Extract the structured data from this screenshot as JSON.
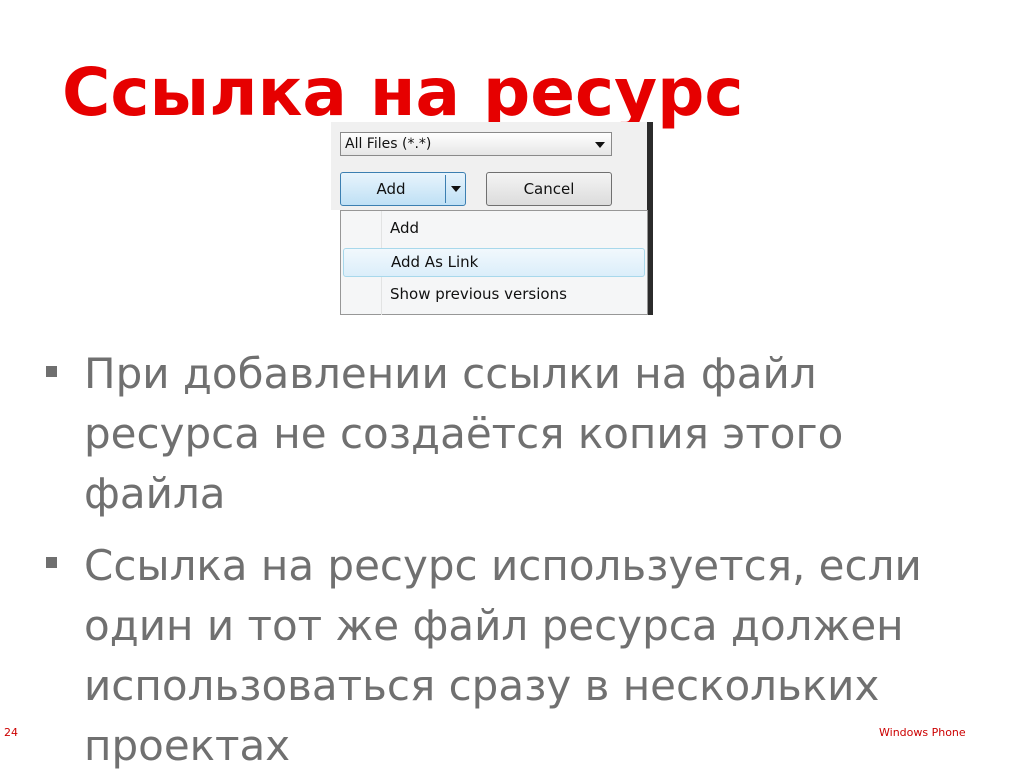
{
  "slide": {
    "title": "Ссылка на ресурс",
    "page_number": "24",
    "footer_brand": "Windows Phone"
  },
  "dialog": {
    "file_filter": "All Files (*.*)",
    "add_button": "Add",
    "cancel_button": "Cancel",
    "menu_items": [
      "Add",
      "Add As Link",
      "Show previous versions"
    ],
    "highlighted_item": "Add As Link"
  },
  "bullets": [
    "При добавлении ссылки на файл ресурса не создаётся копия этого файла",
    "Ссылка на ресурс используется, если один и тот же файл ресурса должен использоваться сразу в нескольких проектах"
  ],
  "colors": {
    "title": "#e60000",
    "body_text": "#707070",
    "bullet_marker": "#6f6f6f",
    "footer_text": "#cc0000"
  }
}
